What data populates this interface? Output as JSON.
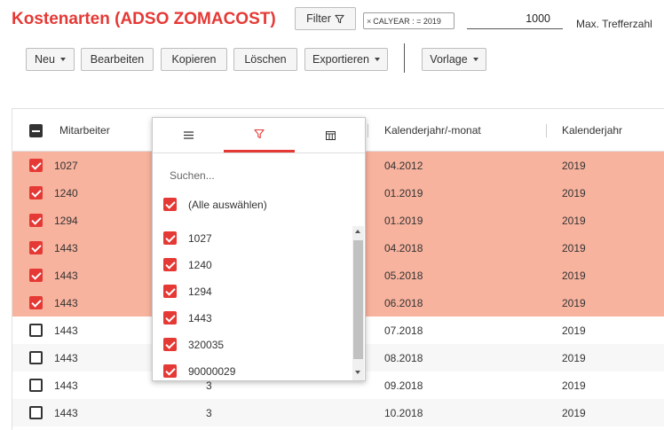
{
  "title": "Kostenarten (ADSO ZOMACOST)",
  "filter_button": "Filter",
  "filter_chip": "CALYEAR : = 2019",
  "max_hits": {
    "value": "1000",
    "label": "Max. Trefferzahl"
  },
  "toolbar": {
    "new": "Neu",
    "edit": "Bearbeiten",
    "copy": "Kopieren",
    "delete": "Löschen",
    "export": "Exportieren",
    "template": "Vorlage"
  },
  "columns": {
    "employee": "Mitarbeiter",
    "month": "Kalenderjahr/-monat",
    "year": "Kalenderjahr"
  },
  "rows": [
    {
      "employee": "1027",
      "mid": "",
      "month": "04.2012",
      "year": "2019",
      "selected": true
    },
    {
      "employee": "1240",
      "mid": "",
      "month": "01.2019",
      "year": "2019",
      "selected": true
    },
    {
      "employee": "1294",
      "mid": "",
      "month": "01.2019",
      "year": "2019",
      "selected": true
    },
    {
      "employee": "1443",
      "mid": "",
      "month": "04.2018",
      "year": "2019",
      "selected": true
    },
    {
      "employee": "1443",
      "mid": "",
      "month": "05.2018",
      "year": "2019",
      "selected": true
    },
    {
      "employee": "1443",
      "mid": "",
      "month": "06.2018",
      "year": "2019",
      "selected": true
    },
    {
      "employee": "1443",
      "mid": "",
      "month": "07.2018",
      "year": "2019",
      "selected": false
    },
    {
      "employee": "1443",
      "mid": "",
      "month": "08.2018",
      "year": "2019",
      "selected": false
    },
    {
      "employee": "1443",
      "mid": "3",
      "month": "09.2018",
      "year": "2019",
      "selected": false
    },
    {
      "employee": "1443",
      "mid": "3",
      "month": "10.2018",
      "year": "2019",
      "selected": false
    }
  ],
  "filter_popup": {
    "search_placeholder": "Suchen...",
    "select_all": "(Alle auswählen)",
    "items": [
      "1027",
      "1240",
      "1294",
      "1443",
      "320035",
      "90000029"
    ]
  },
  "colors": {
    "accent": "#e53935",
    "selected_row": "#f8b39e"
  }
}
